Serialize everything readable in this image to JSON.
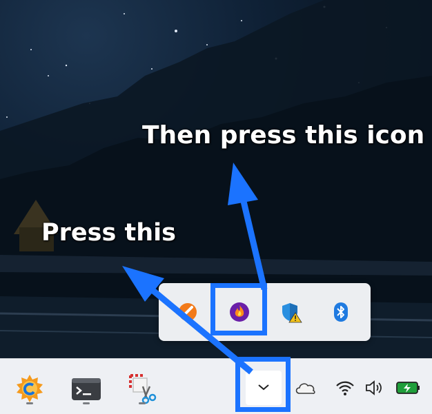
{
  "annotations": {
    "step2_text": "Then press this icon",
    "step1_text": "Press this"
  },
  "colors": {
    "highlight": "#1b73ff",
    "taskbar": "#eef0f4",
    "tray_popup": "#eceef1"
  },
  "tray_popup": {
    "icons": [
      {
        "name": "orange-app-icon"
      },
      {
        "name": "flame-app-icon",
        "highlighted": true
      },
      {
        "name": "security-warning-icon"
      },
      {
        "name": "bluetooth-icon"
      }
    ]
  },
  "taskbar": {
    "pinned": [
      {
        "name": "media-player-icon"
      },
      {
        "name": "terminal-icon"
      },
      {
        "name": "snipping-tool-icon"
      }
    ],
    "tray": [
      {
        "name": "show-hidden-icons-chevron",
        "highlighted": true
      },
      {
        "name": "onedrive-cloud-icon"
      },
      {
        "name": "wifi-icon"
      },
      {
        "name": "volume-icon"
      },
      {
        "name": "battery-charging-icon"
      }
    ]
  }
}
